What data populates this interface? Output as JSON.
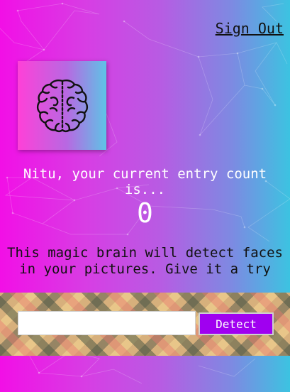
{
  "nav": {
    "sign_out_label": "Sign Out"
  },
  "logo": {
    "icon": "brain-icon"
  },
  "rank": {
    "line1": "Nitu, your current entry count",
    "line2": "is...",
    "count": "0"
  },
  "description": {
    "line1": "This magic brain will detect faces",
    "line2": "in your pictures. Give it a try"
  },
  "form": {
    "input_value": "",
    "input_placeholder": "",
    "detect_label": "Detect"
  },
  "colors": {
    "gradient_left": "#f20fe6",
    "gradient_right": "#3cc3e1",
    "button": "#a000f0"
  }
}
